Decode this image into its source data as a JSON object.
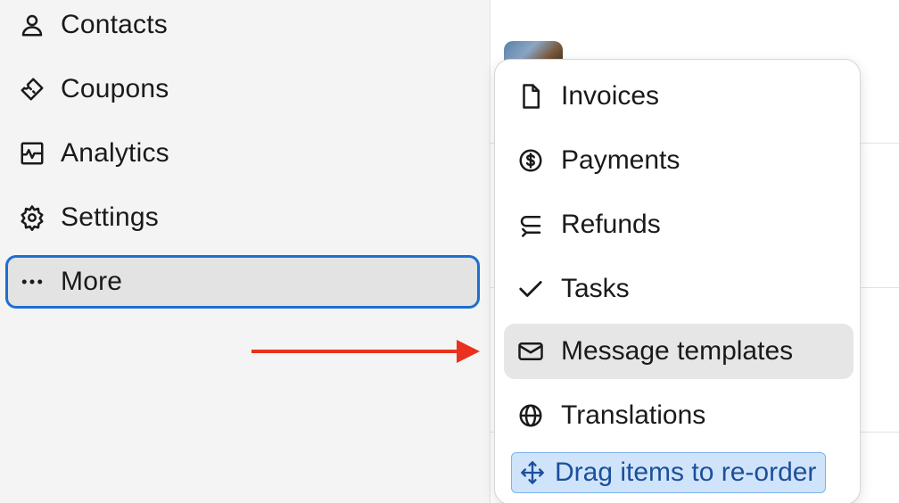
{
  "sidebar": {
    "items": [
      {
        "label": "Contacts",
        "icon": "person-icon"
      },
      {
        "label": "Coupons",
        "icon": "ticket-icon"
      },
      {
        "label": "Analytics",
        "icon": "analytics-icon"
      },
      {
        "label": "Settings",
        "icon": "gear-icon"
      },
      {
        "label": "More",
        "icon": "more-dots-icon",
        "selected": true
      }
    ]
  },
  "more_menu": {
    "items": [
      {
        "label": "Invoices",
        "icon": "document-icon"
      },
      {
        "label": "Payments",
        "icon": "dollar-circle-icon"
      },
      {
        "label": "Refunds",
        "icon": "return-arrow-icon"
      },
      {
        "label": "Tasks",
        "icon": "checkmark-icon"
      },
      {
        "label": "Message templates",
        "icon": "envelope-icon",
        "highlighted": true
      },
      {
        "label": "Translations",
        "icon": "globe-icon"
      }
    ],
    "drag_hint": {
      "label": "Drag items to re-order",
      "icon": "move-arrows-icon"
    }
  },
  "colors": {
    "sidebar_bg": "#f4f4f4",
    "selected_border": "#1e6fd0",
    "annotation_arrow": "#e8321e",
    "hint_bg": "#cfe4fb",
    "hint_text": "#1d4f9a"
  }
}
